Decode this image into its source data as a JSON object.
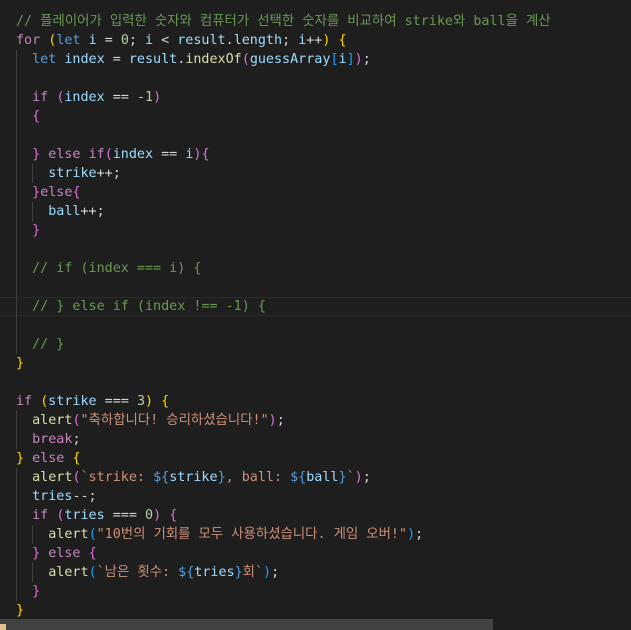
{
  "editor": {
    "lines": [
      [
        [
          "cm",
          "// 플레이어가 입력한 숫자와 컴퓨터가 선택한 숫자를 비교하여 strike와 ball을 계산"
        ]
      ],
      [
        [
          "kw",
          "for"
        ],
        [
          "p",
          " "
        ],
        [
          "b1",
          "("
        ],
        [
          "st",
          "let"
        ],
        [
          "p",
          " "
        ],
        [
          "vr",
          "i"
        ],
        [
          "p",
          " = "
        ],
        [
          "nm",
          "0"
        ],
        [
          "p",
          "; "
        ],
        [
          "vr",
          "i"
        ],
        [
          "p",
          " < "
        ],
        [
          "vr",
          "result"
        ],
        [
          "p",
          "."
        ],
        [
          "vr",
          "length"
        ],
        [
          "p",
          "; "
        ],
        [
          "vr",
          "i"
        ],
        [
          "p",
          "++"
        ],
        [
          "b1",
          ")"
        ],
        [
          "p",
          " "
        ],
        [
          "b1",
          "{"
        ]
      ],
      [
        [
          "p",
          "  "
        ],
        [
          "st",
          "let"
        ],
        [
          "p",
          " "
        ],
        [
          "vr",
          "index"
        ],
        [
          "p",
          " = "
        ],
        [
          "vr",
          "result"
        ],
        [
          "p",
          "."
        ],
        [
          "fn",
          "indexOf"
        ],
        [
          "b2",
          "("
        ],
        [
          "vr",
          "guessArray"
        ],
        [
          "b3",
          "["
        ],
        [
          "vr",
          "i"
        ],
        [
          "b3",
          "]"
        ],
        [
          "b2",
          ")"
        ],
        [
          "p",
          ";"
        ]
      ],
      [],
      [
        [
          "p",
          "  "
        ],
        [
          "kw",
          "if"
        ],
        [
          "p",
          " "
        ],
        [
          "b2",
          "("
        ],
        [
          "vr",
          "index"
        ],
        [
          "p",
          " == "
        ],
        [
          "nm",
          "-1"
        ],
        [
          "b2",
          ")"
        ]
      ],
      [
        [
          "p",
          "  "
        ],
        [
          "b2",
          "{"
        ]
      ],
      [],
      [
        [
          "p",
          "  "
        ],
        [
          "b2",
          "}"
        ],
        [
          "p",
          " "
        ],
        [
          "kw",
          "else"
        ],
        [
          "p",
          " "
        ],
        [
          "kw",
          "if"
        ],
        [
          "b2",
          "("
        ],
        [
          "vr",
          "index"
        ],
        [
          "p",
          " == "
        ],
        [
          "vr",
          "i"
        ],
        [
          "b2",
          ")"
        ],
        [
          "b2",
          "{"
        ]
      ],
      [
        [
          "p",
          "    "
        ],
        [
          "vr",
          "strike"
        ],
        [
          "p",
          "++;"
        ]
      ],
      [
        [
          "p",
          "  "
        ],
        [
          "b2",
          "}"
        ],
        [
          "kw",
          "else"
        ],
        [
          "b2",
          "{"
        ]
      ],
      [
        [
          "p",
          "    "
        ],
        [
          "vr",
          "ball"
        ],
        [
          "p",
          "++;"
        ]
      ],
      [
        [
          "p",
          "  "
        ],
        [
          "b2",
          "}"
        ]
      ],
      [],
      [
        [
          "p",
          "  "
        ],
        [
          "cm",
          "// if (index === i) {"
        ]
      ],
      [],
      [
        [
          "p",
          "  "
        ],
        [
          "cm",
          "// } else if (index !== -1) {"
        ]
      ],
      [],
      [
        [
          "p",
          "  "
        ],
        [
          "cm",
          "// }"
        ]
      ],
      [
        [
          "b1",
          "}"
        ]
      ],
      [],
      [
        [
          "kw",
          "if"
        ],
        [
          "p",
          " "
        ],
        [
          "b1",
          "("
        ],
        [
          "vr",
          "strike"
        ],
        [
          "p",
          " === "
        ],
        [
          "nm",
          "3"
        ],
        [
          "b1",
          ")"
        ],
        [
          "p",
          " "
        ],
        [
          "b1",
          "{"
        ]
      ],
      [
        [
          "p",
          "  "
        ],
        [
          "fn",
          "alert"
        ],
        [
          "b2",
          "("
        ],
        [
          "s",
          "\"축하합니다! 승리하셨습니다!\""
        ],
        [
          "b2",
          ")"
        ],
        [
          "p",
          ";"
        ]
      ],
      [
        [
          "p",
          "  "
        ],
        [
          "kw",
          "break"
        ],
        [
          "p",
          ";"
        ]
      ],
      [
        [
          "b1",
          "}"
        ],
        [
          "p",
          " "
        ],
        [
          "kw",
          "else"
        ],
        [
          "p",
          " "
        ],
        [
          "b1",
          "{"
        ]
      ],
      [
        [
          "p",
          "  "
        ],
        [
          "fn",
          "alert"
        ],
        [
          "b2",
          "("
        ],
        [
          "s",
          "`strike: "
        ],
        [
          "st",
          "${"
        ],
        [
          "vr",
          "strike"
        ],
        [
          "st",
          "}"
        ],
        [
          "s",
          ", ball: "
        ],
        [
          "st",
          "${"
        ],
        [
          "vr",
          "ball"
        ],
        [
          "st",
          "}"
        ],
        [
          "s",
          "`"
        ],
        [
          "b2",
          ")"
        ],
        [
          "p",
          ";"
        ]
      ],
      [
        [
          "p",
          "  "
        ],
        [
          "vr",
          "tries"
        ],
        [
          "p",
          "--;"
        ]
      ],
      [
        [
          "p",
          "  "
        ],
        [
          "kw",
          "if"
        ],
        [
          "p",
          " "
        ],
        [
          "b2",
          "("
        ],
        [
          "vr",
          "tries"
        ],
        [
          "p",
          " === "
        ],
        [
          "nm",
          "0"
        ],
        [
          "b2",
          ")"
        ],
        [
          "p",
          " "
        ],
        [
          "b2",
          "{"
        ]
      ],
      [
        [
          "p",
          "    "
        ],
        [
          "fn",
          "alert"
        ],
        [
          "b3",
          "("
        ],
        [
          "s",
          "\"10번의 기회를 모두 사용하셨습니다. 게임 오버!\""
        ],
        [
          "b3",
          ")"
        ],
        [
          "p",
          ";"
        ]
      ],
      [
        [
          "p",
          "  "
        ],
        [
          "b2",
          "}"
        ],
        [
          "p",
          " "
        ],
        [
          "kw",
          "else"
        ],
        [
          "p",
          " "
        ],
        [
          "b2",
          "{"
        ]
      ],
      [
        [
          "p",
          "    "
        ],
        [
          "fn",
          "alert"
        ],
        [
          "b3",
          "("
        ],
        [
          "s",
          "`남은 횟수: "
        ],
        [
          "st",
          "${"
        ],
        [
          "vr",
          "tries"
        ],
        [
          "st",
          "}"
        ],
        [
          "s",
          "회`"
        ],
        [
          "b3",
          ")"
        ],
        [
          "p",
          ";"
        ]
      ],
      [
        [
          "p",
          "  "
        ],
        [
          "b2",
          "}"
        ]
      ],
      [
        [
          "b1",
          "}"
        ]
      ]
    ]
  }
}
